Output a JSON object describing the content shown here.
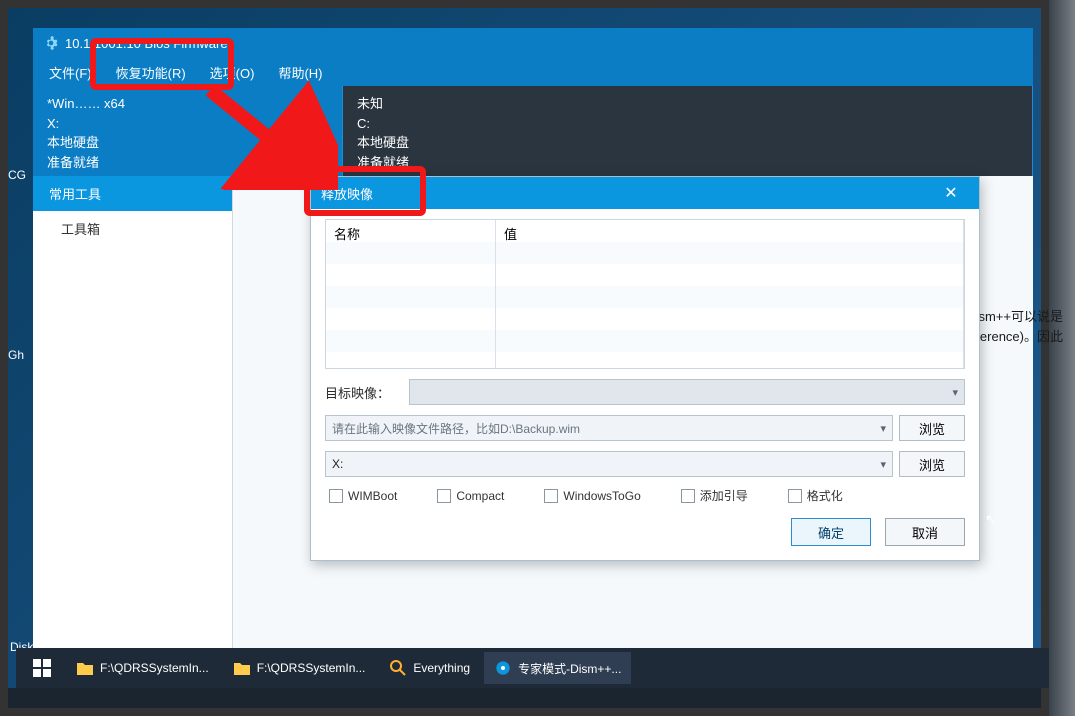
{
  "window": {
    "title_suffix": "10.1.1001.10 Bios Firmware"
  },
  "menu": {
    "file": "文件(F)",
    "recovery": "恢复功能(R)",
    "options": "选项(O)",
    "help": "帮助(H)"
  },
  "drives": {
    "left": {
      "l1": "*Win…… x64",
      "l2": "X:",
      "l3": "本地硬盘",
      "l4": "准备就绪"
    },
    "right": {
      "l1": "未知",
      "l2": "C:",
      "l3": "本地硬盘",
      "l4": "准备就绪"
    }
  },
  "sidebar": {
    "common_tools": "常用工具",
    "toolbox": "工具箱"
  },
  "side_info": {
    "line1": "Dism++可以说是",
    "line2": "Reference)。因此"
  },
  "dialog": {
    "title": "释放映像",
    "col_name": "名称",
    "col_value": "值",
    "target_image_label": "目标映像：",
    "path_placeholder": "请在此输入映像文件路径，比如D:\\Backup.wim",
    "drive_value": "X:",
    "browse": "浏览",
    "chk_wimboot": "WIMBoot",
    "chk_compact": "Compact",
    "chk_wtg": "WindowsToGo",
    "chk_addboot": "添加引导",
    "chk_format": "格式化",
    "ok": "确定",
    "cancel": "取消"
  },
  "taskbar": {
    "item1": "F:\\QDRSSystemIn...",
    "item2": "F:\\QDRSSystemIn...",
    "item3": "Everything",
    "item4": "专家模式-Dism++..."
  },
  "desktop": {
    "icon_diskgenius": "DiskGenius",
    "icon_cg": "CG",
    "icon_gh": "Gh"
  }
}
